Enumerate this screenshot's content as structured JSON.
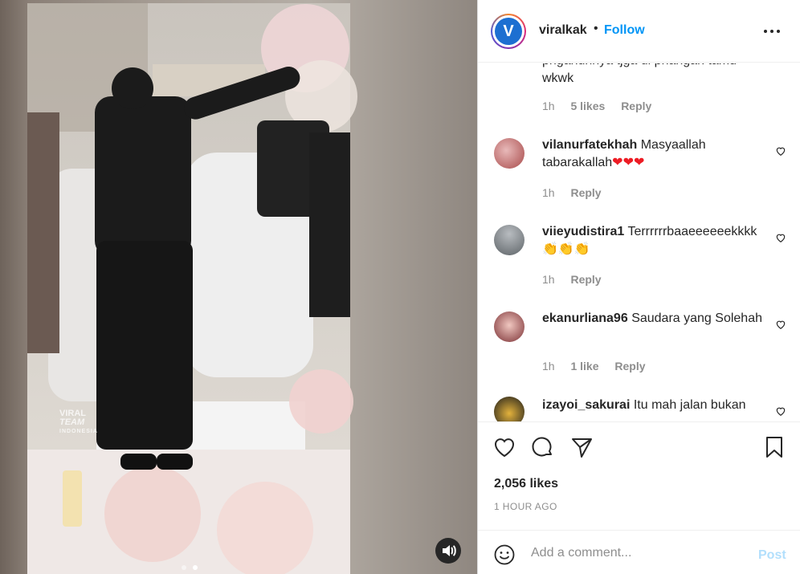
{
  "post": {
    "username": "viralkak",
    "separator": "•",
    "follow_label": "Follow",
    "avatar_text": "V"
  },
  "media": {
    "watermark_line1": "VIRAL",
    "watermark_line2": "TEAM",
    "watermark_line3": "INDONESIA",
    "video_control": "volume-icon"
  },
  "comments": [
    {
      "username": "",
      "text": "pnganunnya tjga di pnangan tamu wkwk",
      "time": "1h",
      "likes": "5 likes",
      "reply": "Reply",
      "partial": true
    },
    {
      "username": "vilanurfatekhah",
      "text": "Masyaallah tabarakallah",
      "emoji": "❤❤❤",
      "time": "1h",
      "reply": "Reply"
    },
    {
      "username": "viieyudistira1",
      "text": "Terrrrrrbaaeeeeeekkkk",
      "emoji": "👏👏👏",
      "time": "1h",
      "reply": "Reply"
    },
    {
      "username": "ekanurliana96",
      "text": "Saudara yang Solehah",
      "time": "1h",
      "likes": "1 like",
      "reply": "Reply"
    },
    {
      "username": "izayoi_sakurai",
      "text": "Itu mah jalan bukan",
      "partial": true
    }
  ],
  "stats": {
    "likes": "2,056 likes",
    "time": "1 HOUR AGO"
  },
  "add_comment": {
    "placeholder": "Add a comment...",
    "post_label": "Post"
  },
  "colors": {
    "accent": "#0095f6",
    "post_disabled": "#b2dffc",
    "meta": "#8e8e8e",
    "text": "#262626"
  }
}
